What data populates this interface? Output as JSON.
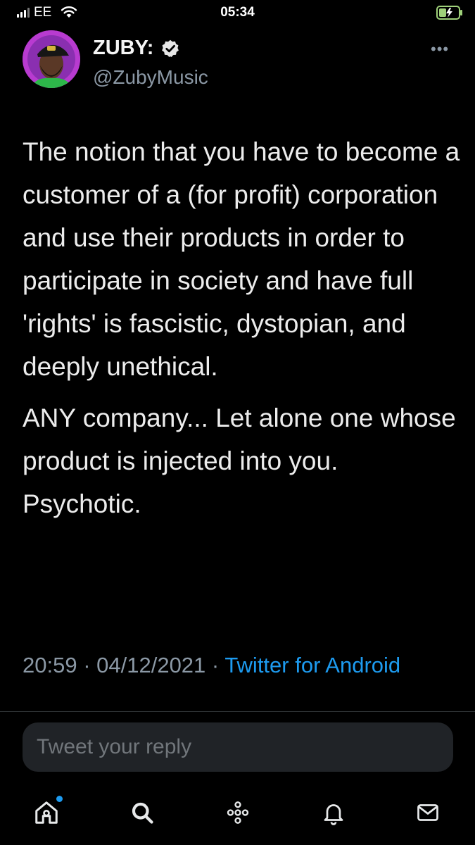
{
  "status_bar": {
    "carrier": "EE",
    "time": "05:34"
  },
  "tweet": {
    "display_name": "ZUBY:",
    "handle": "@ZubyMusic",
    "verified": true,
    "paragraphs": [
      "The notion that you have to become a customer of a (for profit) corporation and use their products in order to participate in society and have full 'rights' is fascistic, dystopian, and deeply unethical.",
      "ANY company... Let alone one whose product is injected into you. Psychotic."
    ],
    "time": "20:59",
    "date": "04/12/2021",
    "source": "Twitter for Android"
  },
  "reply": {
    "placeholder": "Tweet your reply"
  },
  "nav": {
    "items": [
      "home-icon",
      "search-icon",
      "spaces-icon",
      "notifications-icon",
      "messages-icon"
    ],
    "has_notification_dot": true
  },
  "colors": {
    "background": "#000000",
    "accent": "#1d9bf0",
    "muted": "#8b98a5",
    "avatar_bg": "#b83bd0"
  }
}
